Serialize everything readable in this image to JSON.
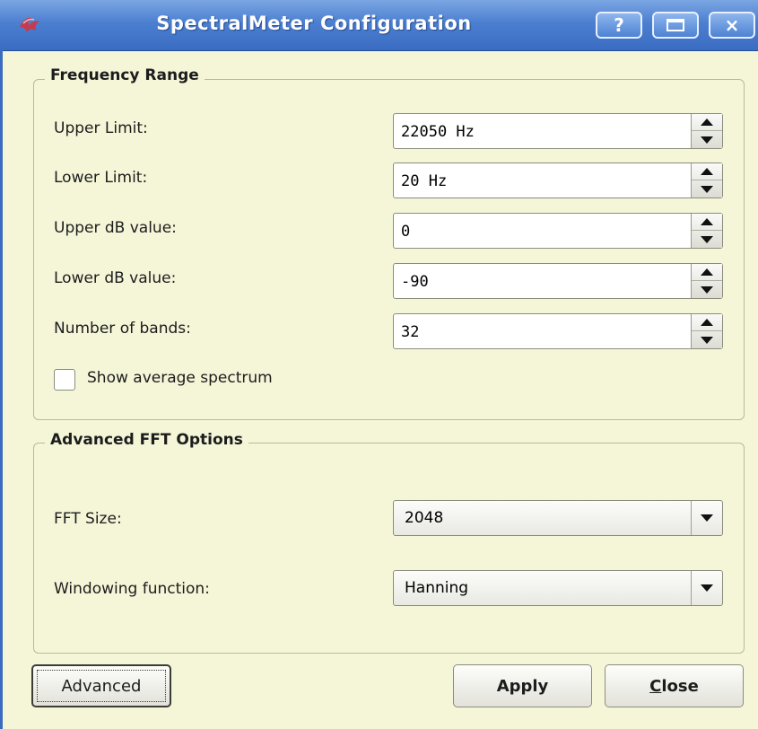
{
  "window": {
    "title": "SpectralMeter Configuration",
    "help_button": "?",
    "close_button": "×"
  },
  "frequency_range": {
    "group_title": "Frequency Range",
    "fields": [
      {
        "label": "Upper Limit:",
        "value": "22050 Hz"
      },
      {
        "label": "Lower Limit:",
        "value": "20 Hz"
      },
      {
        "label": "Upper dB value:",
        "value": "0"
      },
      {
        "label": "Lower dB value:",
        "value": "-90"
      },
      {
        "label": "Number of bands:",
        "value": "32"
      }
    ],
    "show_average": {
      "label": "Show average spectrum",
      "checked": false
    }
  },
  "advanced_fft": {
    "group_title": "Advanced FFT Options",
    "fft_size": {
      "label": "FFT Size:",
      "value": "2048"
    },
    "windowing": {
      "label": "Windowing function:",
      "value": "Hanning"
    }
  },
  "buttons": {
    "advanced": "Advanced",
    "apply": "Apply",
    "close_first": "C",
    "close_rest": "lose"
  },
  "colors": {
    "titlebar": "#4c7fd0",
    "background": "#f5f6d8"
  }
}
